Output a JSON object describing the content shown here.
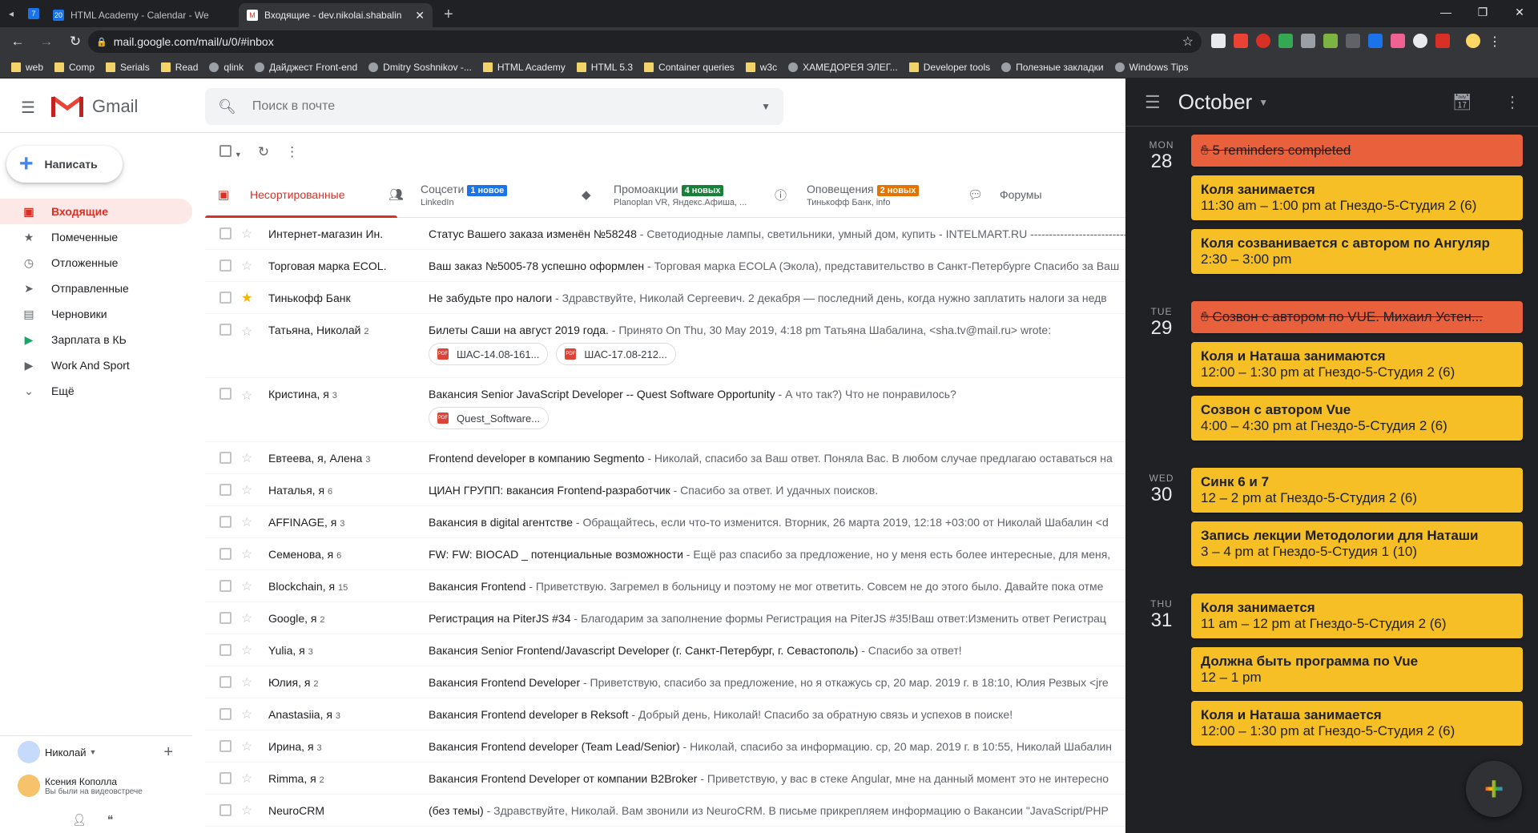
{
  "browser": {
    "tabs": [
      {
        "label": "HTML Academy - Calendar - We",
        "fav": "20"
      },
      {
        "label": "Входящие - dev.nikolai.shabalin",
        "fav": "M"
      }
    ],
    "pinned_fav": "7",
    "url": "mail.google.com/mail/u/0/#inbox",
    "bookmarks": [
      "web",
      "Comp",
      "Serials",
      "Read",
      "qlink",
      "Дайджест Front-end",
      "Dmitry Soshnikov -...",
      "HTML Academy",
      "HTML 5.3",
      "Container queries",
      "w3c",
      "ХАМЕДОРЕЯ ЭЛЕГ...",
      "Developer tools",
      "Полезные закладки",
      "Windows Tips"
    ]
  },
  "gmail": {
    "app_name": "Gmail",
    "search_placeholder": "Поиск в почте",
    "compose_label": "Написать",
    "nav": [
      "Входящие",
      "Помеченные",
      "Отложенные",
      "Отправленные",
      "Черновики",
      "Зарплата в КЬ",
      "Work And Sport",
      "Ещё"
    ],
    "hangouts": {
      "user": "Николай",
      "contact": "Ксения Кополла",
      "contact_status": "Вы были на видеовстрече"
    },
    "tabs": [
      {
        "label": "Несортированные",
        "sub": "",
        "badge": "",
        "color": ""
      },
      {
        "label": "Соцсети",
        "sub": "LinkedIn",
        "badge": "1 новое",
        "color": "#1a73e8"
      },
      {
        "label": "Промоакции",
        "sub": "Planoplan VR, Яндекс.Афиша, ...",
        "badge": "4 новых",
        "color": "#188038"
      },
      {
        "label": "Оповещения",
        "sub": "Тинькофф Банк, info",
        "badge": "2 новых",
        "color": "#e37400"
      },
      {
        "label": "Форумы",
        "sub": "",
        "badge": "",
        "color": ""
      }
    ],
    "emails": [
      {
        "from": "Интернет-магазин Ин.",
        "count": "",
        "subject": "Статус Вашего заказа изменён №58248",
        "snippet": " - Светодиодные лампы, светильники, умный дом, купить - INTELMART.RU ----------------------------",
        "starred": false
      },
      {
        "from": "Торговая марка ECOL.",
        "count": "",
        "subject": "Ваш заказ №5005-78 успешно оформлен",
        "snippet": " - Торговая марка ECOLA (Экола), представительство в Санкт-Петербурге Спасибо за Ваш",
        "starred": false
      },
      {
        "from": "Тинькофф Банк",
        "count": "",
        "subject": "Не забудьте про налоги",
        "snippet": " - Здравствуйте, Николай Сергеевич. 2 декабря — последний день, когда нужно заплатить налоги за недв",
        "starred": true
      },
      {
        "from": "Татьяна, Николай",
        "count": "2",
        "subject": "Билеты Саши на август 2019 года.",
        "snippet": " - Принято On Thu, 30 May 2019, 4:18 pm Татьяна Шабалина, <sha.tv@mail.ru> wrote:",
        "starred": false,
        "chips": [
          "ШАС-14.08-161...",
          "ШАС-17.08-212..."
        ]
      },
      {
        "from": "Кристина, я",
        "count": "3",
        "subject": "Вакансия Senior JavaScript Developer -- Quest Software Opportunity",
        "snippet": " - А что так?) Что не понравилось?",
        "starred": false,
        "chips": [
          "Quest_Software..."
        ]
      },
      {
        "from": "Евтеева, я, Алена",
        "count": "3",
        "subject": "Frontend developer в компанию Segmento",
        "snippet": " - Николай, спасибо за Ваш ответ. Поняла Вас. В любом случае предлагаю оставаться на",
        "starred": false
      },
      {
        "from": "Наталья, я",
        "count": "6",
        "subject": "ЦИАН ГРУПП: вакансия Frontend-разработчик",
        "snippet": " - Спасибо за ответ. И удачных поисков.",
        "starred": false
      },
      {
        "from": "AFFINAGE, я",
        "count": "3",
        "subject": "Вакансия в digital агентстве",
        "snippet": " - Обращайтесь, если что-то изменится. Вторник, 26 марта 2019, 12:18 +03:00 от Николай Шабалин <d",
        "starred": false
      },
      {
        "from": "Семенова, я",
        "count": "6",
        "subject": "FW: FW: BIOCAD _ потенциальные возможности",
        "snippet": " - Ещё раз спасибо за предложение, но у меня есть более интересные, для меня,",
        "starred": false
      },
      {
        "from": "Blockchain, я",
        "count": "15",
        "subject": "Вакансия Frontend",
        "snippet": " - Приветствую. Загремел в больницу и поэтому не мог ответить. Совсем не до этого было. Давайте пока отме",
        "starred": false
      },
      {
        "from": "Google, я",
        "count": "2",
        "subject": "Регистрация на PiterJS #34",
        "snippet": " - Благодарим за заполнение формы Регистрация на PiterJS #35!Ваш ответ:Изменить ответ Регистрац",
        "starred": false
      },
      {
        "from": "Yulia, я",
        "count": "3",
        "subject": "Вакансия Senior Frontend/Javascript Developer (г. Санкт-Петербург, г. Севастополь)",
        "snippet": " - Спасибо за ответ!",
        "starred": false
      },
      {
        "from": "Юлия, я",
        "count": "2",
        "subject": "Вакансия Frontend Developer",
        "snippet": " - Приветствую, спасибо за предложение, но я откажусь ср, 20 мар. 2019 г. в 18:10, Юлия Резвых <jre",
        "starred": false
      },
      {
        "from": "Anastasiia, я",
        "count": "3",
        "subject": "Вакансия Frontend developer в Reksoft",
        "snippet": " - Добрый день, Николай! Спасибо за обратную связь и успехов в поиске!",
        "starred": false
      },
      {
        "from": "Ирина, я",
        "count": "3",
        "subject": "Вакансия Frontend developer (Team Lead/Senior)",
        "snippet": " - Николай, спасибо за информацию. ср, 20 мар. 2019 г. в 10:55, Николай Шабалин",
        "starred": false
      },
      {
        "from": "Rimma, я",
        "count": "2",
        "subject": "Вакансия Frontend Developer от компании B2Broker",
        "snippet": " - Приветствую, у вас в стеке Angular, мне на данный момент это не интересно",
        "starred": false
      },
      {
        "from": "NeuroCRM",
        "count": "",
        "subject": "(без темы)",
        "snippet": " - Здравствуйте, Николай. Вам звонили из NeuroCRM. В письме прикрепляем информацию о Вакансии \"JavaScript/PHP",
        "starred": false
      }
    ]
  },
  "calendar": {
    "month": "October",
    "days": [
      {
        "dow": "MON",
        "num": "28",
        "events": [
          {
            "title": "5 reminders completed",
            "time": "",
            "done": true
          },
          {
            "title": "Коля занимается",
            "time": "11:30 am – 1:00 pm at Гнездо-5-Студия 2 (6)",
            "done": false
          },
          {
            "title": "Коля созванивается с автором по Ангуляр",
            "time": "2:30 – 3:00 pm",
            "done": false
          }
        ]
      },
      {
        "dow": "TUE",
        "num": "29",
        "events": [
          {
            "title": "Созвон с автором по VUE. Михаил Устен...",
            "time": "",
            "done": true
          },
          {
            "title": "Коля и Наташа занимаются",
            "time": "12:00 – 1:30 pm at Гнездо-5-Студия 2 (6)",
            "done": false
          },
          {
            "title": "Созвон с автором Vue",
            "time": "4:00 – 4:30 pm at Гнездо-5-Студия 2 (6)",
            "done": false
          }
        ]
      },
      {
        "dow": "WED",
        "num": "30",
        "events": [
          {
            "title": "Синк 6 и 7",
            "time": "12 – 2 pm at Гнездо-5-Студия 2 (6)",
            "done": false
          },
          {
            "title": "Запись лекции Методологии для Наташи",
            "time": "3 – 4 pm at Гнездо-5-Студия 1 (10)",
            "done": false
          }
        ]
      },
      {
        "dow": "THU",
        "num": "31",
        "events": [
          {
            "title": "Коля занимается",
            "time": "11 am – 12 pm at Гнездо-5-Студия 2 (6)",
            "done": false
          },
          {
            "title": "Должна быть программа по Vue",
            "time": "12 – 1 pm",
            "done": false
          },
          {
            "title": "Коля и Наташа занимается",
            "time": "12:00 – 1:30 pm at Гнездо-5-Студия 2 (6)",
            "done": false
          }
        ]
      }
    ]
  },
  "colors": {
    "accent_red": "#d93025",
    "event_yellow": "#f6bf26",
    "event_done": "#e8603c",
    "calendar_bg": "#202124"
  }
}
